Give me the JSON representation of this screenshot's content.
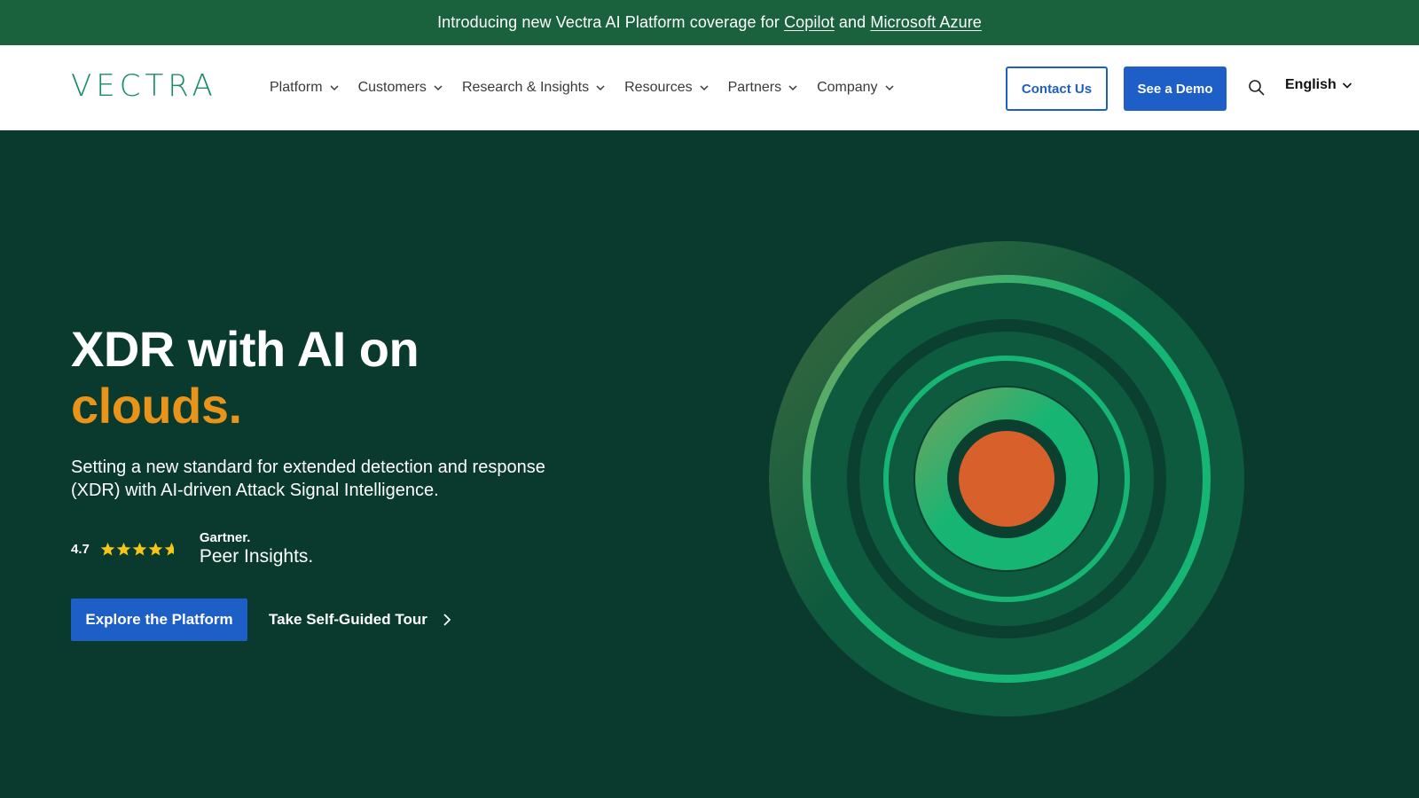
{
  "announcement": {
    "prefix": "Introducing new Vectra AI Platform coverage for ",
    "link1": "Copilot",
    "middle": " and ",
    "link2": "Microsoft Azure"
  },
  "header": {
    "logo": "VECTRA",
    "nav": [
      {
        "label": "Platform"
      },
      {
        "label": "Customers"
      },
      {
        "label": "Research & Insights"
      },
      {
        "label": "Resources"
      },
      {
        "label": "Partners"
      },
      {
        "label": "Company"
      }
    ],
    "contact_label": "Contact Us",
    "demo_label": "See a Demo",
    "language": "English"
  },
  "hero": {
    "title_line1": "XDR with AI on",
    "title_line2": "clouds.",
    "subtitle": "Setting a new standard for extended detection and response (XDR) with AI-driven Attack Signal Intelligence.",
    "rating": "4.7",
    "rating_value": 4.7,
    "rating_max": 5,
    "gartner_brand": "Gartner.",
    "gartner_product": "Peer Insights.",
    "explore_label": "Explore the Platform",
    "tour_label": "Take Self-Guided Tour"
  },
  "colors": {
    "announcement_bg": "#1a623d",
    "hero_bg": "#0a3a2e",
    "primary_blue": "#1d5fc7",
    "accent_orange": "#e8941a",
    "ring_green": "#17b574",
    "core_orange": "#d8602a",
    "star_yellow": "#f5c518"
  },
  "icons": {
    "search": "search-icon",
    "chevron": "chevron-down-icon",
    "arrow": "chevron-right-icon",
    "star": "star-icon"
  }
}
